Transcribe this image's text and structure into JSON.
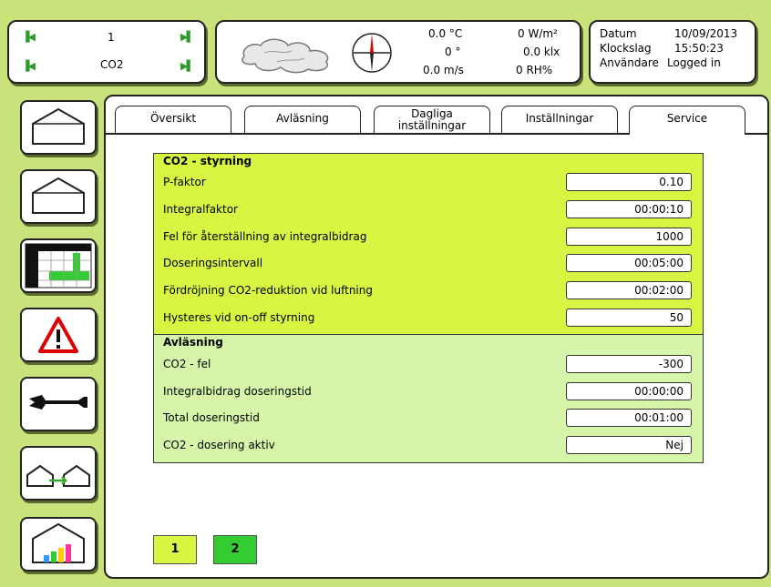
{
  "top": {
    "selector": {
      "row1_value": "1",
      "row2_value": "CO2"
    },
    "weather": {
      "temp": "0.0 °C",
      "angle": "0 °",
      "wind": "0.0 m/s",
      "radiation": "0 W/m²",
      "light": "0.0 klx",
      "humidity": "0 RH%"
    },
    "info": {
      "date_label": "Datum",
      "date_value": "10/09/2013",
      "time_label": "Klockslag",
      "time_value": "15:50:23",
      "user_label": "Användare",
      "user_value": "Logged in"
    }
  },
  "tabs": [
    {
      "label": "Översikt"
    },
    {
      "label": "Avläsning"
    },
    {
      "label": "Dagliga inställningar"
    },
    {
      "label": "Inställningar"
    },
    {
      "label": "Service"
    }
  ],
  "active_tab": "Service",
  "section1": {
    "title": "CO2 - styrning",
    "rows": [
      {
        "label": "P-faktor",
        "value": "0.10"
      },
      {
        "label": "Integralfaktor",
        "value": "00:00:10"
      },
      {
        "label": "Fel för återställning av integralbidrag",
        "value": "1000"
      },
      {
        "label": "Doseringsintervall",
        "value": "00:05:00"
      },
      {
        "label": "Fördröjning CO2-reduktion vid luftning",
        "value": "00:02:00"
      },
      {
        "label": "Hysteres vid on-off styrning",
        "value": "50"
      }
    ]
  },
  "section2": {
    "title": "Avläsning",
    "rows": [
      {
        "label": "CO2 - fel",
        "value": "-300"
      },
      {
        "label": "Integralbidrag doseringstid",
        "value": "00:00:00"
      },
      {
        "label": "Total doseringstid",
        "value": "00:01:00"
      },
      {
        "label": "CO2 - dosering aktiv",
        "value": "Nej"
      }
    ]
  },
  "pages": [
    "1",
    "2"
  ],
  "colors": {
    "background": "#c9e27a",
    "section1": "#d8f542",
    "section2": "#d6f5a8",
    "active_page": "#33cc33"
  },
  "icons": [
    "prev-icon",
    "next-icon",
    "wind-compass-icon",
    "cloud-icon",
    "greenhouse-icon",
    "schedule-grid-icon",
    "warning-icon",
    "wrench-icon",
    "greenhouse-transfer-icon",
    "greenhouse-chart-icon"
  ]
}
